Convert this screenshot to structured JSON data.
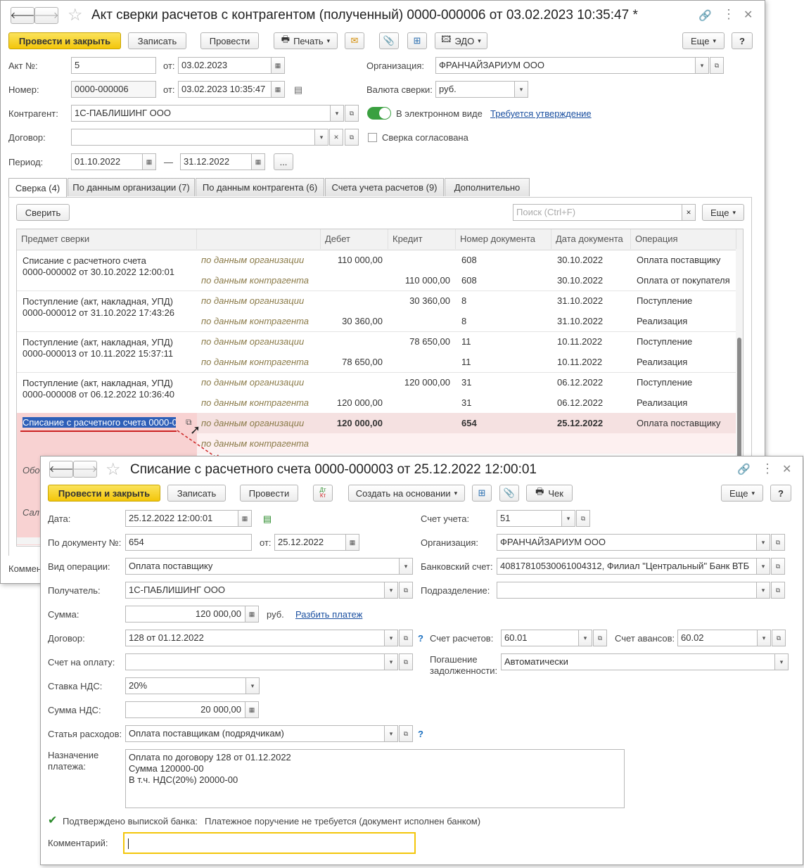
{
  "main": {
    "title": "Акт сверки расчетов с контрагентом (полученный) 0000-000006 от 03.02.2023 10:35:47 *",
    "toolbar": {
      "post_close": "Провести и закрыть",
      "save": "Записать",
      "post": "Провести",
      "print": "Печать",
      "edo": "ЭДО",
      "more": "Еще",
      "help": "?"
    },
    "fields": {
      "act_no_label": "Акт №:",
      "act_no": "5",
      "from_label": "от:",
      "act_date": "03.02.2023",
      "number_label": "Номер:",
      "number": "0000-000006",
      "number_date": "03.02.2023 10:35:47",
      "counterparty_label": "Контрагент:",
      "counterparty": "1С-ПАБЛИШИНГ ООО",
      "contract_label": "Договор:",
      "contract": "",
      "period_label": "Период:",
      "period_from": "01.10.2022",
      "period_dash": "—",
      "period_to": "31.12.2022",
      "period_btn": "...",
      "org_label": "Организация:",
      "org": "ФРАНЧАЙЗАРИУМ ООО",
      "currency_label": "Валюта сверки:",
      "currency": "руб.",
      "electronic_label": "В электронном виде",
      "approval_link": "Требуется утверждение",
      "agreed_label": "Сверка согласована"
    },
    "tabs": [
      "Сверка (4)",
      "По данным организации (7)",
      "По данным контрагента (6)",
      "Счета учета расчетов (9)",
      "Дополнительно"
    ],
    "reconcile_button": "Сверить",
    "search_placeholder": "Поиск (Ctrl+F)",
    "table_more": "Еще",
    "columns": [
      "Предмет сверки",
      "",
      "Дебет",
      "Кредит",
      "Номер документа",
      "Дата документа",
      "Операция"
    ],
    "groups": [
      {
        "subject1": "Списание с расчетного счета",
        "subject2": "0000-000002 от 30.10.2022 12:00:01",
        "rows": [
          {
            "source": "по данным организации",
            "debit": "110 000,00",
            "credit": "",
            "doc": "608",
            "date": "30.10.2022",
            "op": "Оплата поставщику"
          },
          {
            "source": "по данным контрагента",
            "debit": "",
            "credit": "110 000,00",
            "doc": "608",
            "date": "30.10.2022",
            "op": "Оплата от покупателя"
          }
        ]
      },
      {
        "subject1": "Поступление (акт, накладная, УПД)",
        "subject2": "0000-000012 от 31.10.2022 17:43:26",
        "rows": [
          {
            "source": "по данным организации",
            "debit": "",
            "credit": "30 360,00",
            "doc": "8",
            "date": "31.10.2022",
            "op": "Поступление"
          },
          {
            "source": "по данным контрагента",
            "debit": "30 360,00",
            "credit": "",
            "doc": "8",
            "date": "31.10.2022",
            "op": "Реализация"
          }
        ]
      },
      {
        "subject1": "Поступление (акт, накладная, УПД)",
        "subject2": "0000-000013 от 10.11.2022 15:37:11",
        "rows": [
          {
            "source": "по данным организации",
            "debit": "",
            "credit": "78 650,00",
            "doc": "11",
            "date": "10.11.2022",
            "op": "Поступление"
          },
          {
            "source": "по данным контрагента",
            "debit": "78 650,00",
            "credit": "",
            "doc": "11",
            "date": "10.11.2022",
            "op": "Реализация"
          }
        ]
      },
      {
        "subject1": "Поступление (акт, накладная, УПД)",
        "subject2": "0000-000008 от 06.12.2022 10:36:40",
        "rows": [
          {
            "source": "по данным организации",
            "debit": "",
            "credit": "120 000,00",
            "doc": "31",
            "date": "06.12.2022",
            "op": "Поступление"
          },
          {
            "source": "по данным контрагента",
            "debit": "120 000,00",
            "credit": "",
            "doc": "31",
            "date": "06.12.2022",
            "op": "Реализация"
          }
        ]
      }
    ],
    "highlighted_group": {
      "subject": "Списание с расчетного счета 0000-0",
      "rows": [
        {
          "source": "по данным организации",
          "debit": "120 000,00",
          "credit": "",
          "doc": "654",
          "date": "25.12.2022",
          "op": "Оплата поставщику"
        },
        {
          "source": "по данным контрагента",
          "debit": "",
          "credit": "",
          "doc": "",
          "date": "",
          "op": ""
        }
      ]
    },
    "footer_partial": [
      "Обо",
      "Сал"
    ],
    "comment_partial": "Коммент"
  },
  "popup": {
    "title": "Списание с расчетного счета 0000-000003 от 25.12.2022 12:00:01",
    "toolbar": {
      "post_close": "Провести и закрыть",
      "save": "Записать",
      "post": "Провести",
      "create_basis": "Создать на основании",
      "check": "Чек",
      "more": "Еще",
      "help": "?"
    },
    "dtkt_icon_text_top": "Дт",
    "dtkt_icon_text_bottom": "Кт",
    "fields": {
      "date_label": "Дата:",
      "date": "25.12.2022 12:00:01",
      "doc_no_label": "По документу №:",
      "doc_no": "654",
      "doc_from_label": "от:",
      "doc_date": "25.12.2022",
      "operation_label": "Вид операции:",
      "operation": "Оплата поставщику",
      "recipient_label": "Получатель:",
      "recipient": "1С-ПАБЛИШИНГ ООО",
      "amount_label": "Сумма:",
      "amount": "120 000,00",
      "amount_currency": "руб.",
      "split_link": "Разбить платеж",
      "contract_label": "Договор:",
      "contract": "128 от 01.12.2022",
      "invoice_label": "Счет на оплату:",
      "invoice": "",
      "vat_rate_label": "Ставка НДС:",
      "vat_rate": "20%",
      "vat_amount_label": "Сумма НДС:",
      "vat_amount": "20 000,00",
      "expense_label": "Статья расходов:",
      "expense": "Оплата поставщикам (подрядчикам)",
      "purpose_label1": "Назначение",
      "purpose_label2": "платежа:",
      "purpose_lines": [
        "Оплата по договору 128 от 01.12.2022",
        "Сумма 120000-00",
        "В т.ч. НДС(20%) 20000-00"
      ],
      "bank_confirmed_label": "Подтверждено выпиской банка:",
      "bank_confirmed_note": "Платежное поручение не требуется (документ исполнен банком)",
      "comment_label": "Комментарий:",
      "comment": "",
      "account_label": "Счет учета:",
      "account": "51",
      "org_label": "Организация:",
      "org": "ФРАНЧАЙЗАРИУМ ООО",
      "bank_account_label": "Банковский счет:",
      "bank_account": "40817810530061004312, Филиал \"Центральный\" Банк ВТБ",
      "division_label": "Подразделение:",
      "division": "",
      "settle_account_label": "Счет расчетов:",
      "settle_account": "60.01",
      "advance_account_label": "Счет авансов:",
      "advance_account": "60.02",
      "repayment_label1": "Погашение",
      "repayment_label2": "задолженности:",
      "repayment": "Автоматически",
      "question_mark": "?"
    }
  },
  "colors": {
    "accent_yellow": "#f3c60a",
    "highlight_row": "#fbe6e6",
    "link": "#1a4fa0",
    "toggle_green": "#3aa040"
  }
}
